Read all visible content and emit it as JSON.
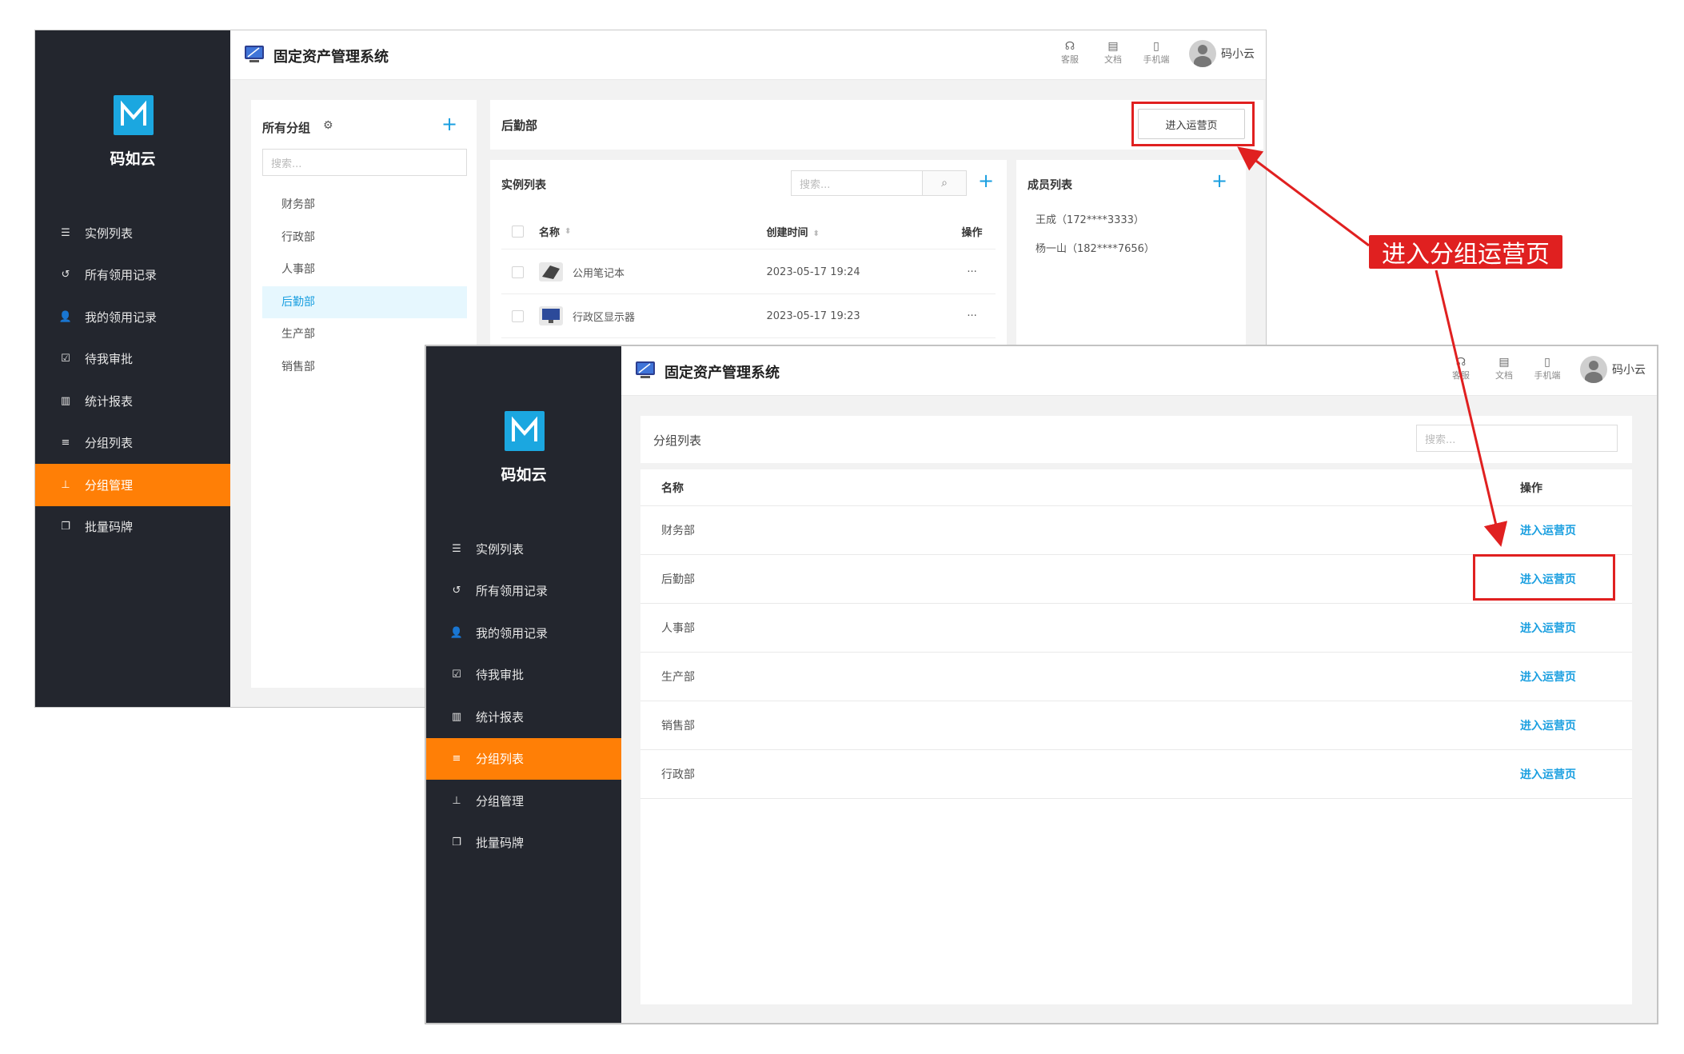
{
  "app": {
    "brand": "码如云",
    "title": "固定资产管理系统",
    "topbar": [
      {
        "label": "客服",
        "icon": "headset-icon"
      },
      {
        "label": "文档",
        "icon": "book-icon"
      },
      {
        "label": "手机端",
        "icon": "phone-icon"
      }
    ],
    "user": "码小云"
  },
  "menu": [
    {
      "label": "实例列表",
      "icon": "list-icon"
    },
    {
      "label": "所有领用记录",
      "icon": "history-icon"
    },
    {
      "label": "我的领用记录",
      "icon": "user-check-icon"
    },
    {
      "label": "待我审批",
      "icon": "checkbox-icon"
    },
    {
      "label": "统计报表",
      "icon": "bar-chart-icon"
    },
    {
      "label": "分组列表",
      "icon": "menu-lines-icon"
    },
    {
      "label": "分组管理",
      "icon": "org-tree-icon"
    },
    {
      "label": "批量码牌",
      "icon": "cards-icon"
    }
  ],
  "window1": {
    "active_menu": "分组管理",
    "groups": {
      "title": "所有分组",
      "search_placeholder": "搜索...",
      "items": [
        "财务部",
        "行政部",
        "人事部",
        "后勤部",
        "生产部",
        "销售部"
      ],
      "selected": "后勤部"
    },
    "header": {
      "title": "后勤部",
      "button": "进入运营页"
    },
    "instances": {
      "title": "实例列表",
      "search_placeholder": "搜索...",
      "columns": [
        "名称",
        "创建时间",
        "操作"
      ],
      "rows": [
        {
          "name": "公用笔记本",
          "created": "2023-05-17 19:24",
          "op": "···"
        },
        {
          "name": "行政区显示器",
          "created": "2023-05-17 19:23",
          "op": "···"
        }
      ]
    },
    "members": {
      "title": "成员列表",
      "items": [
        "王成（172****3333）",
        "杨一山（182****7656）"
      ]
    }
  },
  "window2": {
    "active_menu": "分组列表",
    "title": "分组列表",
    "search_placeholder": "搜索...",
    "columns": [
      "名称",
      "操作"
    ],
    "rows": [
      {
        "name": "财务部",
        "action": "进入运营页"
      },
      {
        "name": "后勤部",
        "action": "进入运营页"
      },
      {
        "name": "人事部",
        "action": "进入运营页"
      },
      {
        "name": "生产部",
        "action": "进入运营页"
      },
      {
        "name": "销售部",
        "action": "进入运营页"
      },
      {
        "name": "行政部",
        "action": "进入运营页"
      }
    ]
  },
  "annotation": {
    "label": "进入分组运营页",
    "color": "#e02020"
  },
  "colors": {
    "sidebar": "#23262e",
    "active": "#ff7f06",
    "accent": "#1a9fe0",
    "logo": "#1ba7e0"
  }
}
